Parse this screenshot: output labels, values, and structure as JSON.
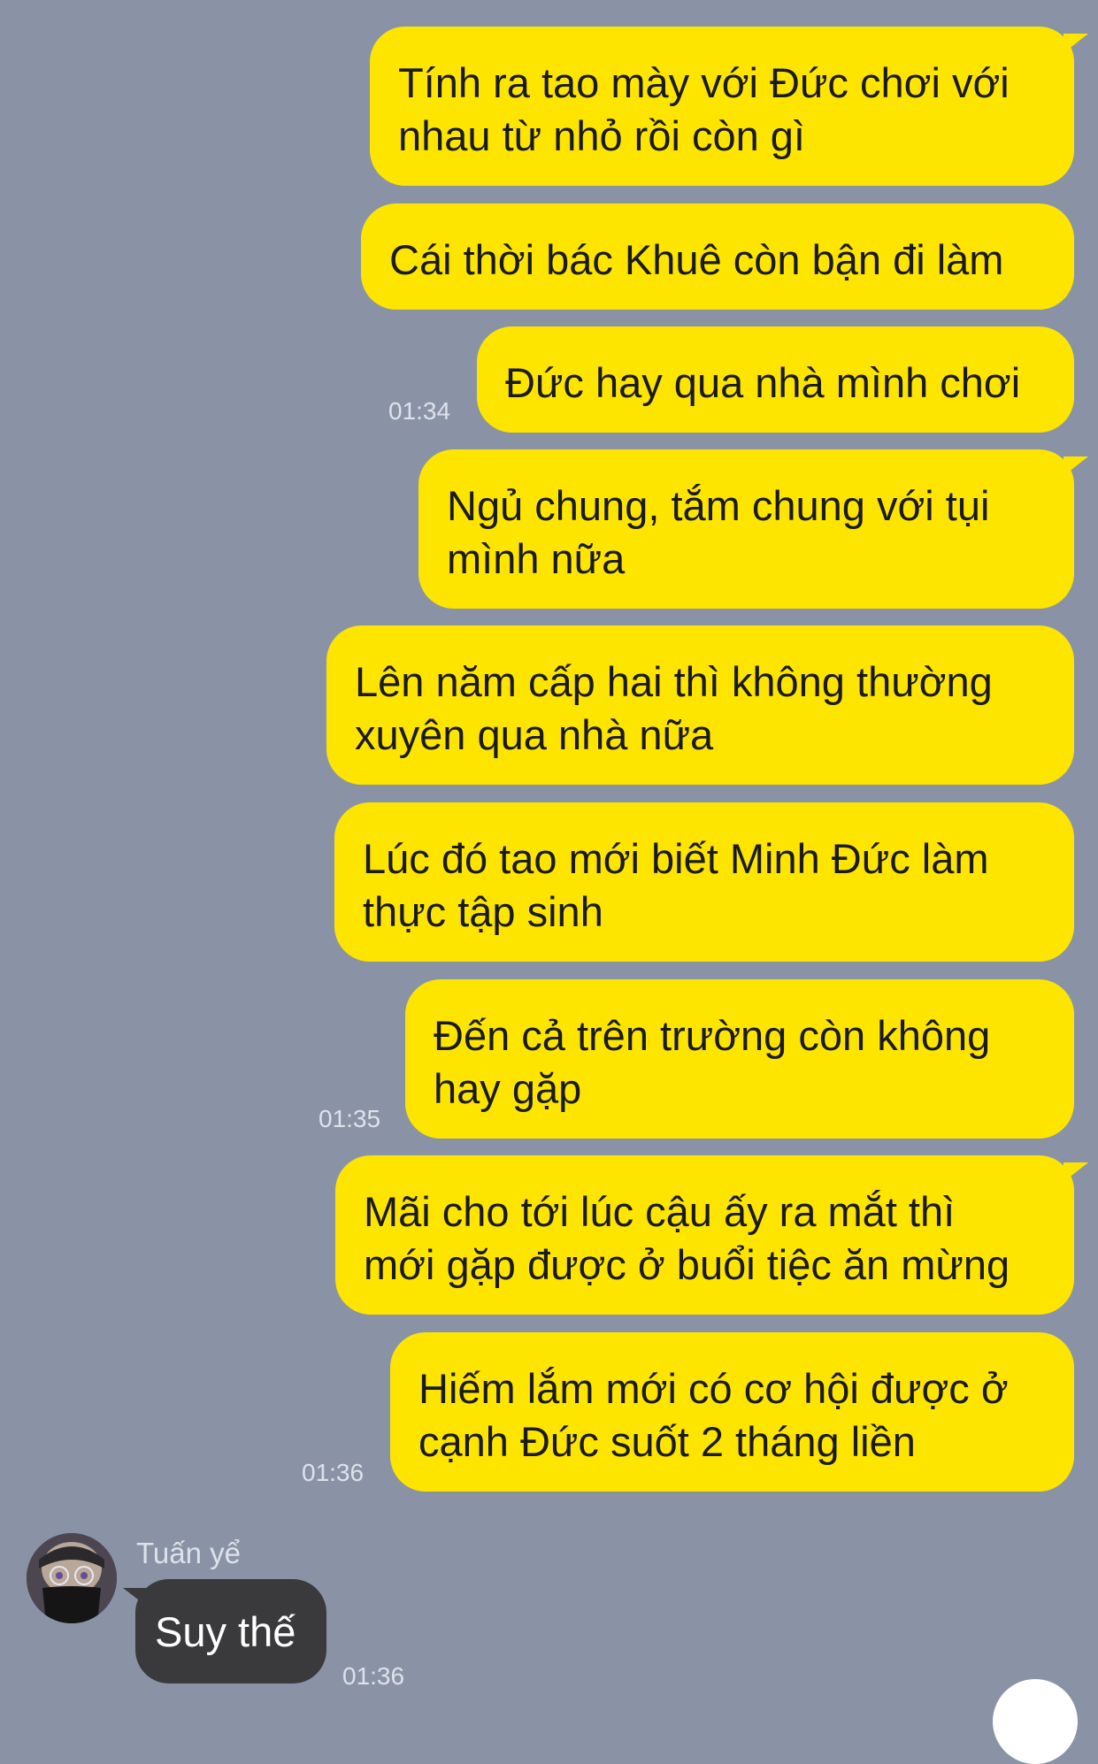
{
  "messages": [
    {
      "text": "Tính ra tao mày với Đức chơi với\nnhau từ nhỏ rồi còn gì"
    },
    {
      "text": "Cái thời bác Khuê còn bận đi làm"
    },
    {
      "text": "Đức hay qua nhà mình chơi",
      "time": "01:34"
    },
    {
      "text": "Ngủ chung, tắm chung với tụi\nmình nữa"
    },
    {
      "text": "Lên năm cấp hai thì không thường\nxuyên qua nhà nữa"
    },
    {
      "text": "Lúc đó tao mới biết Minh Đức làm\nthực tập sinh"
    },
    {
      "text": "Đến cả trên trường còn không\nhay gặp",
      "time": "01:35"
    },
    {
      "text": "Mãi cho tới lúc cậu ấy ra mắt thì\nmới gặp được ở buổi tiệc ăn mừng"
    },
    {
      "text": "Hiếm lắm mới có cơ hội được ở\ncạnh Đức suốt 2 tháng liền",
      "time": "01:36"
    }
  ],
  "incoming": {
    "sender": "Tuấn yể",
    "text": "Suy thế",
    "time": "01:36"
  }
}
